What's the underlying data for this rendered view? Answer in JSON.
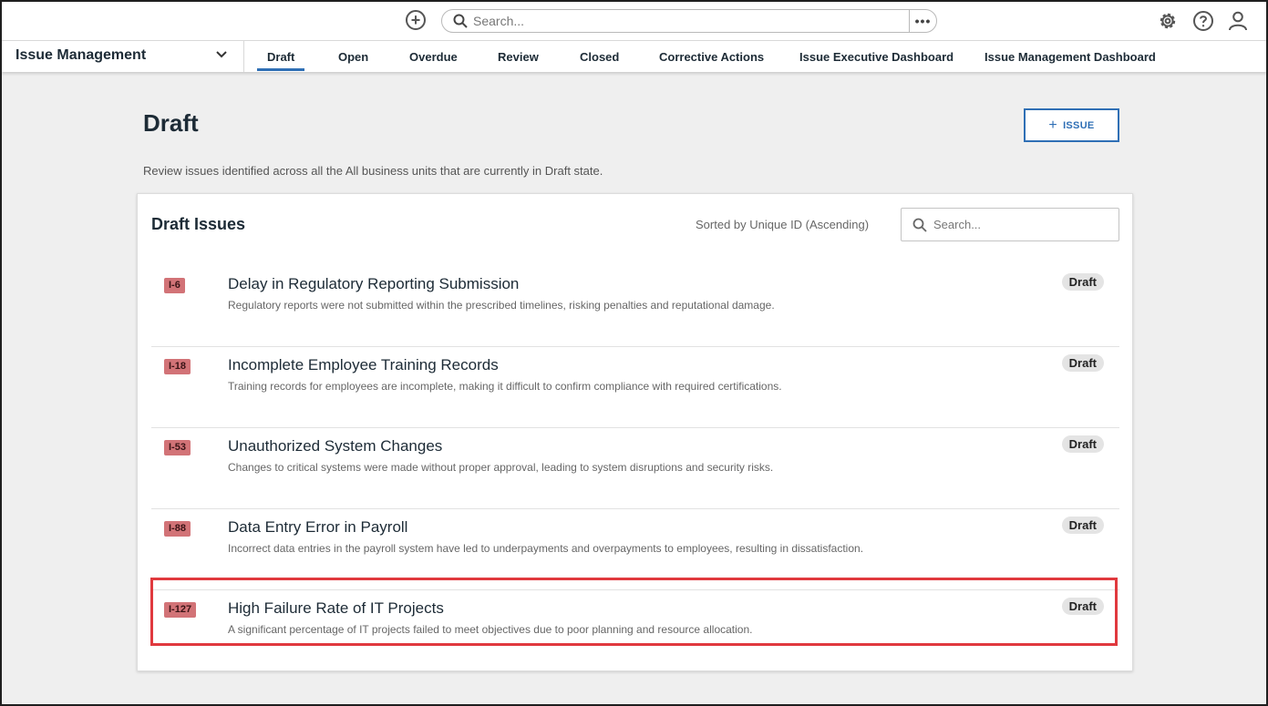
{
  "topbar": {
    "add_icon": "plus-circle-icon",
    "search_placeholder": "Search...",
    "more_label": "•••",
    "icons": [
      "gear-icon",
      "help-icon",
      "user-icon"
    ]
  },
  "nav": {
    "app_name": "Issue Management",
    "active_tab": "Draft",
    "tabs": [
      "Draft",
      "Open",
      "Overdue",
      "Review",
      "Closed",
      "Corrective Actions",
      "Issue Executive Dashboard",
      "Issue Management Dashboard"
    ]
  },
  "page": {
    "title": "Draft",
    "new_button_label": "ISSUE",
    "description": "Review issues identified across all the All business units that are currently in Draft state."
  },
  "card": {
    "title": "Draft Issues",
    "sort_label": "Sorted by Unique ID (Ascending)",
    "search_placeholder": "Search...",
    "rows": [
      {
        "id": "I-6",
        "title": "Delay in Regulatory Reporting Submission",
        "description": "Regulatory reports were not submitted within the prescribed timelines, risking penalties and reputational damage.",
        "state": "Draft"
      },
      {
        "id": "I-18",
        "title": "Incomplete Employee Training Records",
        "description": "Training records for employees are incomplete, making it difficult to confirm compliance with required certifications.",
        "state": "Draft"
      },
      {
        "id": "I-53",
        "title": "Unauthorized System Changes",
        "description": "Changes to critical systems were made without proper approval, leading to system disruptions and security risks.",
        "state": "Draft"
      },
      {
        "id": "I-88",
        "title": "Data Entry Error in Payroll",
        "description": "Incorrect data entries in the payroll system have led to underpayments and overpayments to employees, resulting in dissatisfaction.",
        "state": "Draft"
      },
      {
        "id": "I-127",
        "title": "High Failure Rate of IT Projects",
        "description": "A significant percentage of IT projects failed to meet objectives due to poor planning and resource allocation.",
        "state": "Draft"
      }
    ]
  },
  "colors": {
    "accent": "#2f6fb5",
    "id_badge": "#d27377",
    "highlight": "#e0393e"
  }
}
